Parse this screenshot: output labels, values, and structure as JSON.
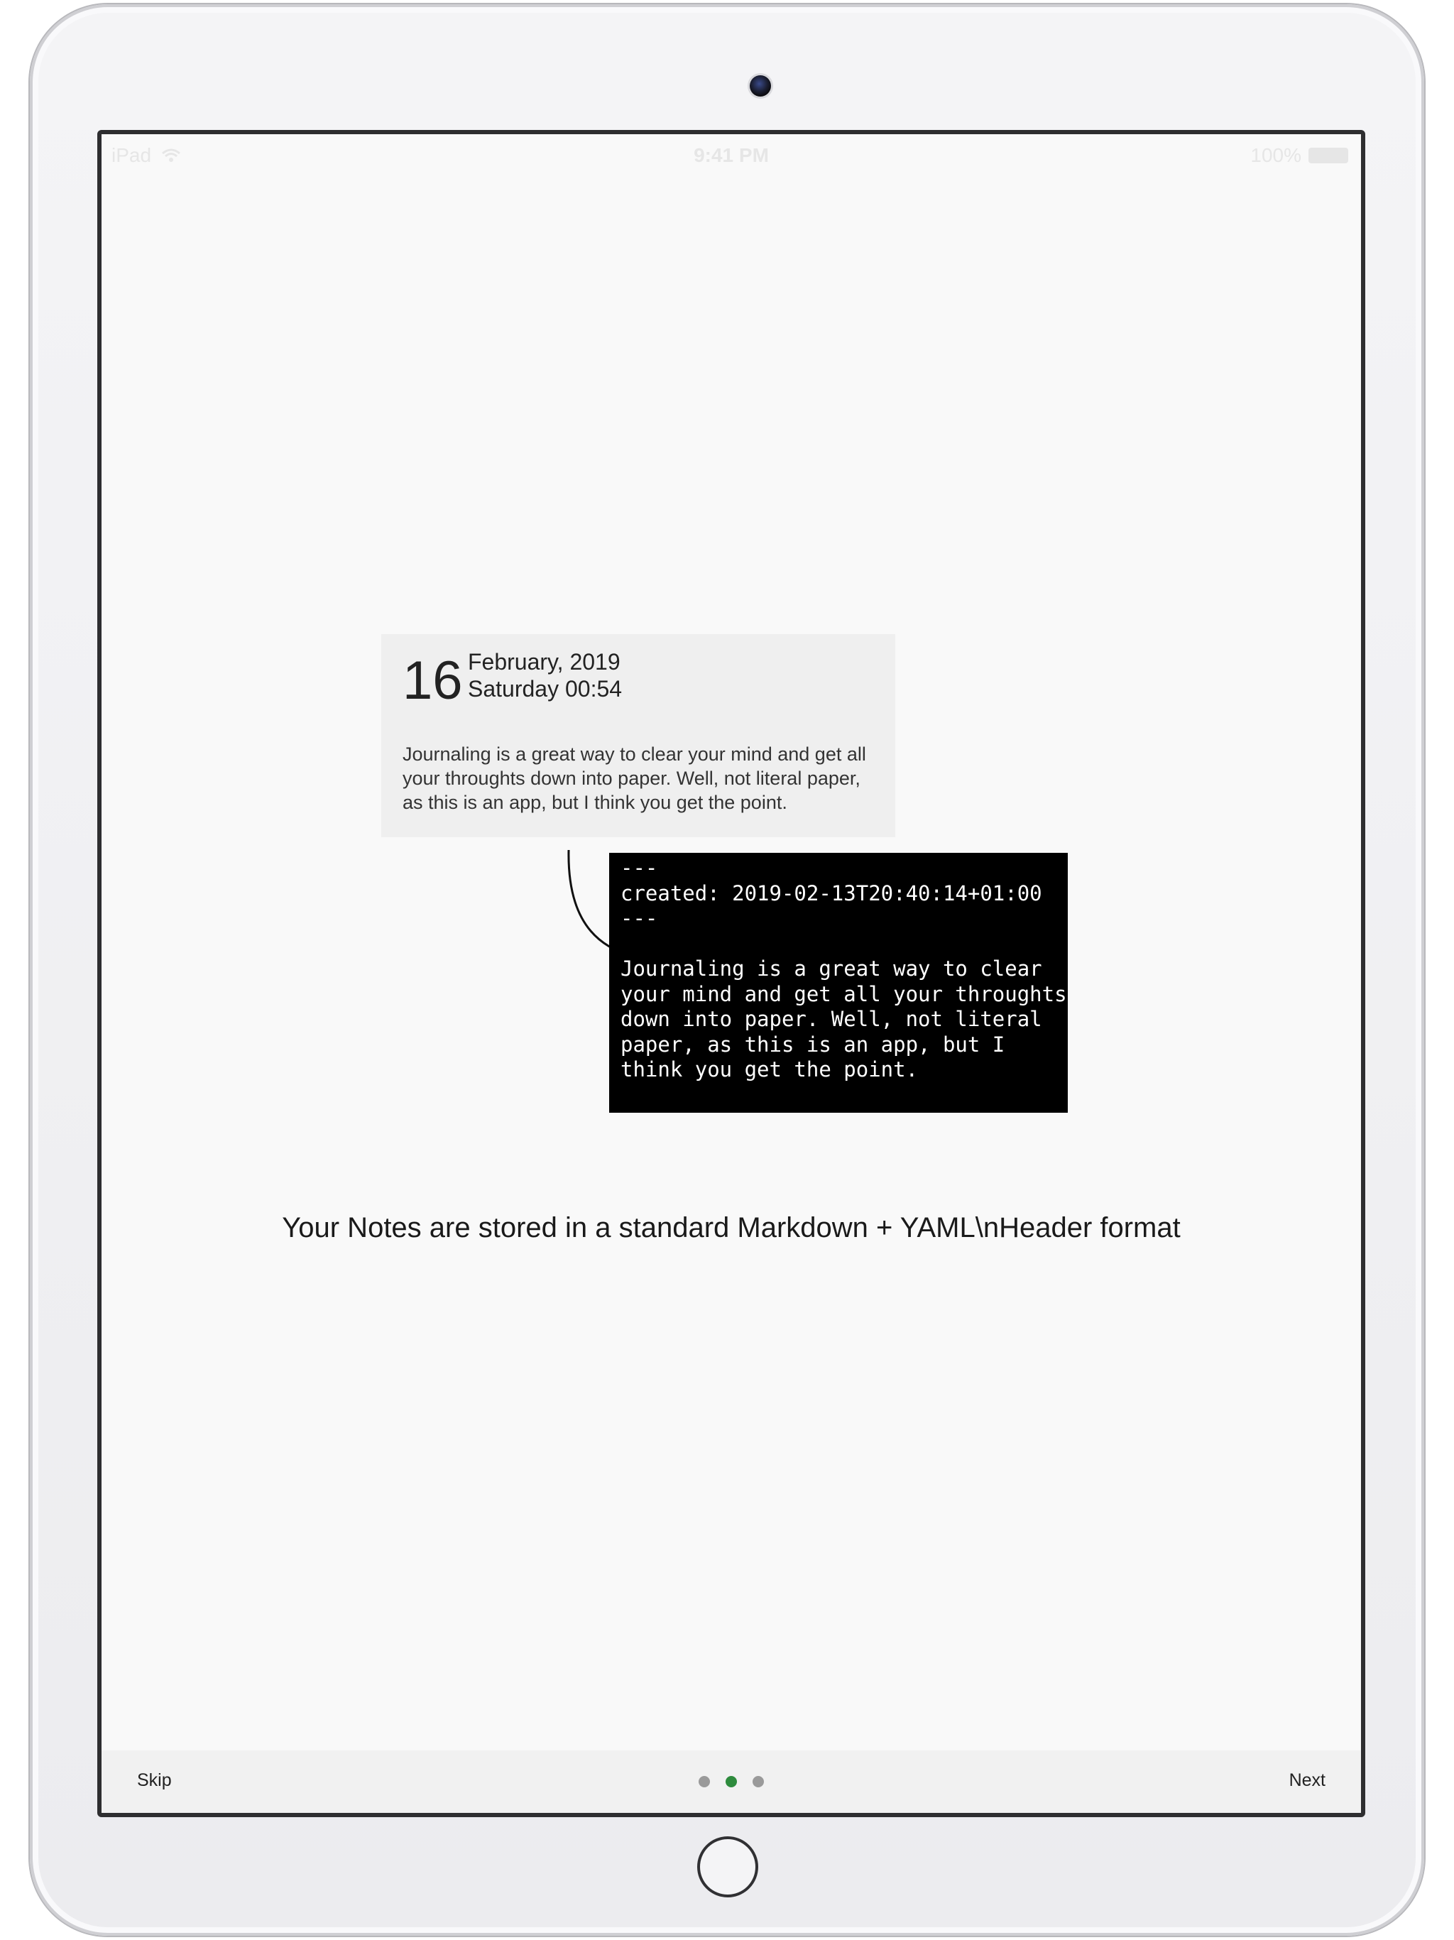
{
  "status_bar": {
    "carrier": "iPad",
    "time": "9:41 PM",
    "battery": "100%"
  },
  "note_card": {
    "day": "16",
    "month_year": "February, 2019",
    "weekday_time": "Saturday 00:54",
    "body": "Journaling is a great way to clear your mind and get all your throughts down into paper. Well, not literal paper, as this is an app, but I think you get the point."
  },
  "terminal": {
    "text": "---\ncreated: 2019-02-13T20:40:14+01:00\n---\n\nJournaling is a great way to clear\nyour mind and get all your throughts\ndown into paper. Well, not literal\npaper, as this is an app, but I\nthink you get the point."
  },
  "caption": "Your Notes are stored in a standard Markdown + YAML\\nHeader format",
  "bottom_bar": {
    "skip_label": "Skip",
    "next_label": "Next",
    "page_count": 3,
    "active_page": 2
  },
  "colors": {
    "active_dot": "#2e8b3d",
    "inactive_dot": "#9a9a9a",
    "terminal_bg": "#000000"
  },
  "icons": [
    "camera-icon",
    "wifi-icon",
    "battery-icon",
    "home-button-icon",
    "curved-arrow-icon"
  ]
}
